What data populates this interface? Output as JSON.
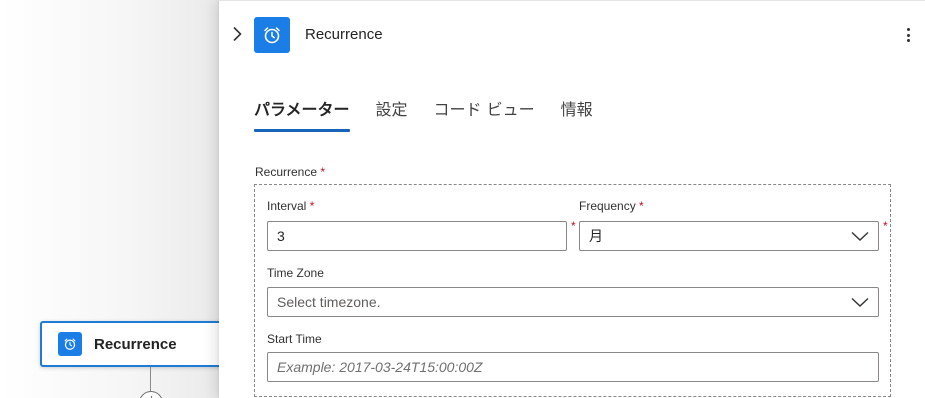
{
  "canvas": {
    "card": {
      "title": "Recurrence",
      "icon": "alarm-clock-icon"
    }
  },
  "panel": {
    "title": "Recurrence",
    "icon": "alarm-clock-icon",
    "tabs": [
      {
        "label": "パラメーター",
        "active": true
      },
      {
        "label": "設定",
        "active": false
      },
      {
        "label": "コード ビュー",
        "active": false
      },
      {
        "label": "情報",
        "active": false
      }
    ],
    "section": {
      "label": "Recurrence",
      "required_mark": "*"
    },
    "fields": {
      "interval": {
        "label": "Interval",
        "required_mark": "*",
        "value": "3"
      },
      "frequency": {
        "label": "Frequency",
        "required_mark": "*",
        "value": "月"
      },
      "timezone": {
        "label": "Time Zone",
        "placeholder": "Select timezone."
      },
      "start_time": {
        "label": "Start Time",
        "placeholder": "Example: 2017-03-24T15:00:00Z"
      }
    }
  },
  "colors": {
    "accent": "#1a7ee6",
    "tab_underline": "#1764b8",
    "required": "#c50f1f",
    "card_border": "#1f7bd6"
  }
}
